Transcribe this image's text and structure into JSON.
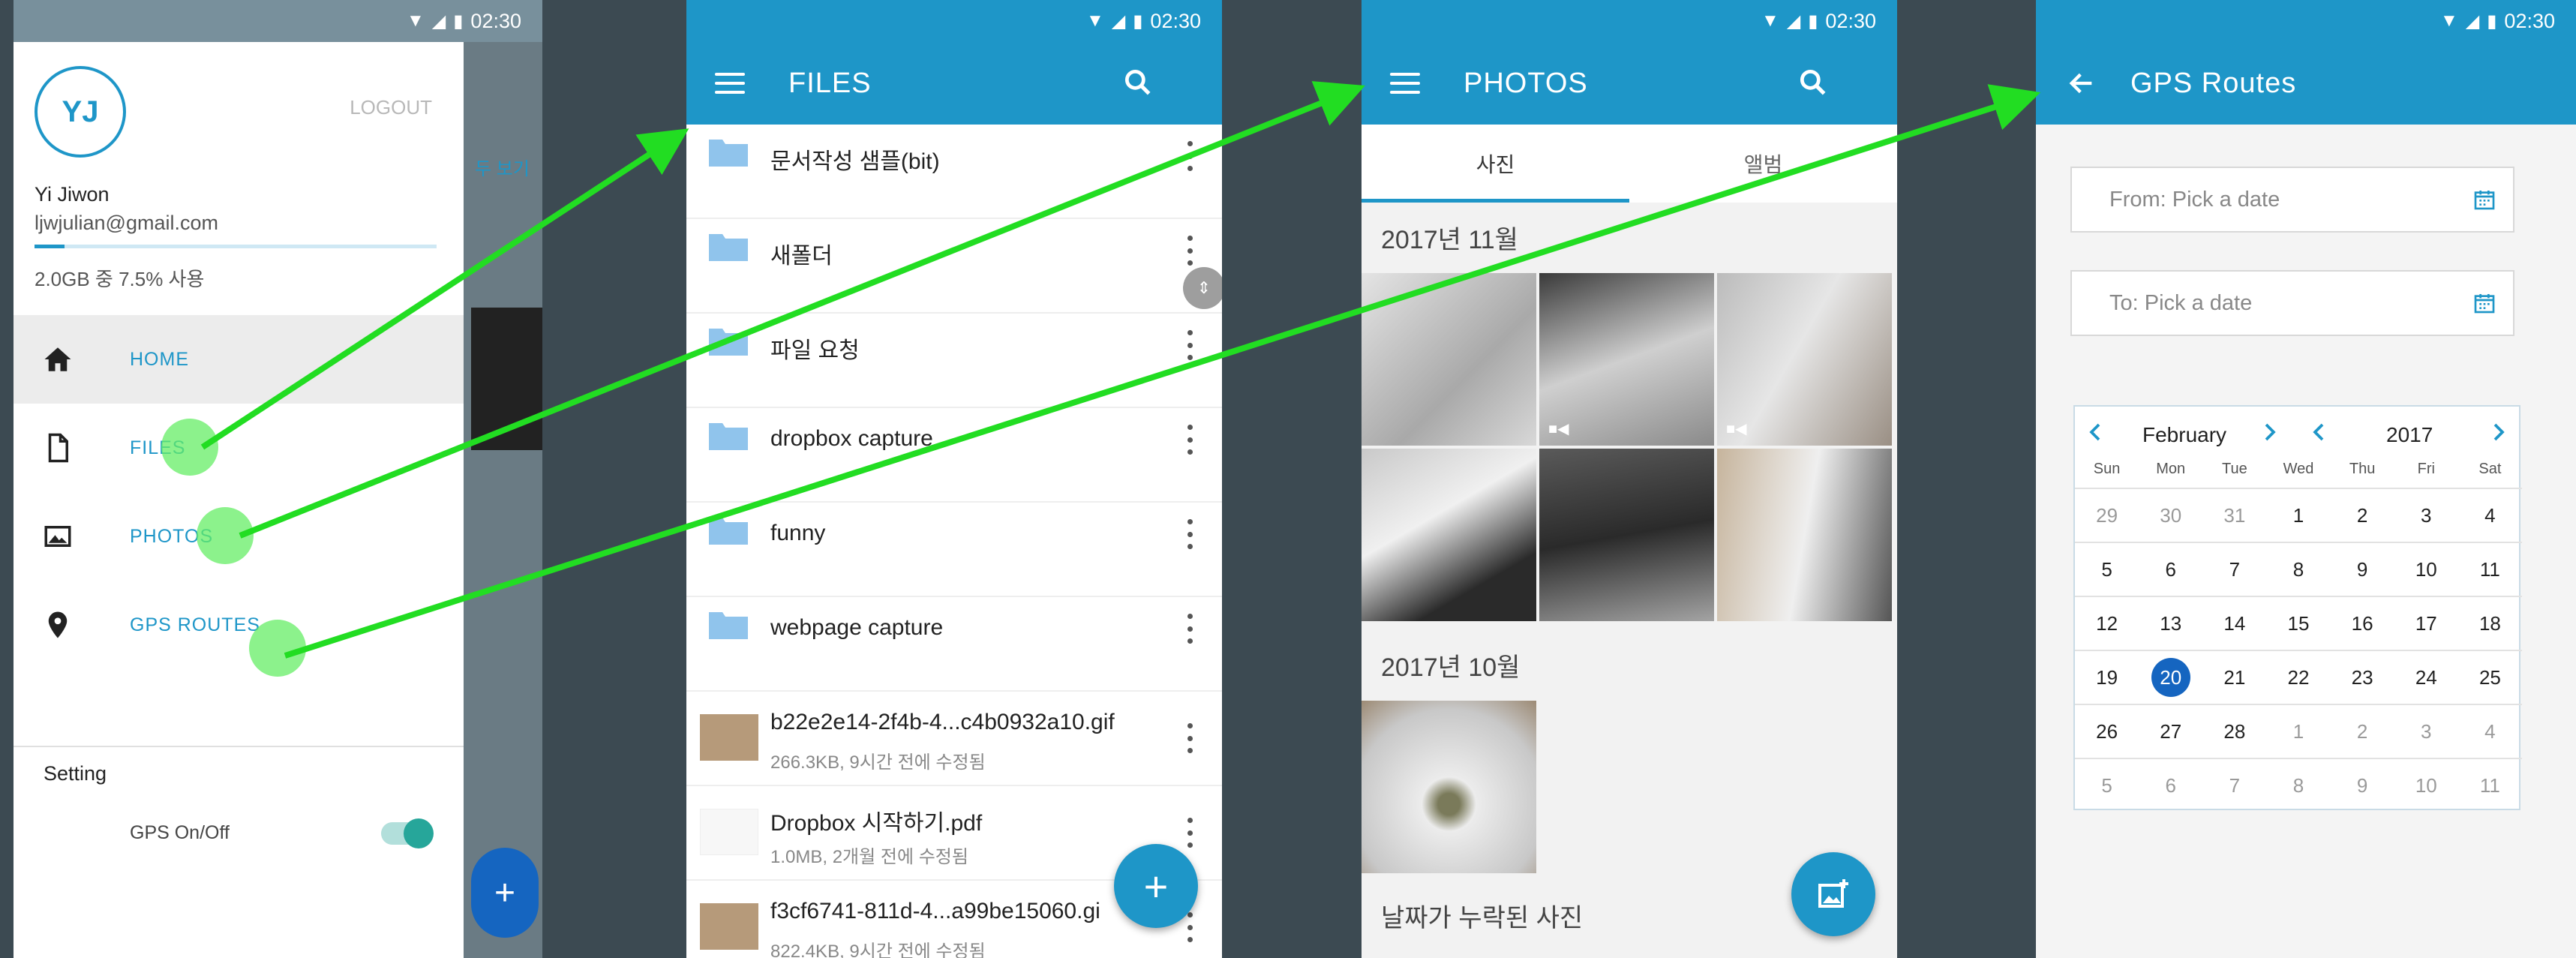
{
  "status": {
    "time": "02:30"
  },
  "drawer": {
    "avatar_initials": "YJ",
    "logout": "LOGOUT",
    "user_name": "Yi Jiwon",
    "user_email": "ljwjulian@gmail.com",
    "quota_text": "2.0GB 중 7.5% 사용",
    "quota_fraction": 0.075,
    "nav": [
      {
        "label": "HOME",
        "icon": "home-icon"
      },
      {
        "label": "FILES",
        "icon": "file-icon"
      },
      {
        "label": "PHOTOS",
        "icon": "image-icon"
      },
      {
        "label": "GPS ROUTES",
        "icon": "location-pin-icon"
      }
    ],
    "setting_label": "Setting",
    "gps_toggle_label": "GPS On/Off",
    "gps_toggle_on": true,
    "behind_text": "두 보기"
  },
  "files": {
    "title": "FILES",
    "items": [
      {
        "name": "문서작성 샘플(bit)",
        "type": "folder"
      },
      {
        "name": "새폴더",
        "type": "folder"
      },
      {
        "name": "파일 요청",
        "type": "folder"
      },
      {
        "name": "dropbox capture",
        "type": "folder"
      },
      {
        "name": "funny",
        "type": "folder"
      },
      {
        "name": "webpage capture",
        "type": "folder"
      },
      {
        "name": "b22e2e14-2f4b-4...c4b0932a10.gif",
        "meta": "266.3KB, 9시간 전에 수정됨",
        "type": "image"
      },
      {
        "name": "Dropbox 시작하기.pdf",
        "meta": "1.0MB, 2개월 전에 수정됨",
        "type": "pdf"
      },
      {
        "name": "f3cf6741-811d-4...a99be15060.gi",
        "meta": "822.4KB, 9시간 전에 수정됨",
        "type": "image"
      }
    ],
    "fab": "+"
  },
  "photos": {
    "title": "PHOTOS",
    "tabs": [
      "사진",
      "앨범"
    ],
    "sections": [
      "2017년 11월",
      "2017년 10월",
      "날짜가 누락된 사진"
    ]
  },
  "gps": {
    "title": "GPS Routes",
    "from_placeholder": "From: Pick a date",
    "to_placeholder": "To: Pick a date",
    "calendar": {
      "month": "February",
      "year": "2017",
      "weekdays": [
        "Sun",
        "Mon",
        "Tue",
        "Wed",
        "Thu",
        "Fri",
        "Sat"
      ],
      "weeks": [
        [
          "29",
          "30",
          "31",
          "1",
          "2",
          "3",
          "4"
        ],
        [
          "5",
          "6",
          "7",
          "8",
          "9",
          "10",
          "11"
        ],
        [
          "12",
          "13",
          "14",
          "15",
          "16",
          "17",
          "18"
        ],
        [
          "19",
          "20",
          "21",
          "22",
          "23",
          "24",
          "25"
        ],
        [
          "26",
          "27",
          "28",
          "1",
          "2",
          "3",
          "4"
        ],
        [
          "5",
          "6",
          "7",
          "8",
          "9",
          "10",
          "11"
        ]
      ],
      "selected": "20"
    }
  },
  "colors": {
    "primary": "#1e96c8",
    "annotation": "#22dd22"
  }
}
